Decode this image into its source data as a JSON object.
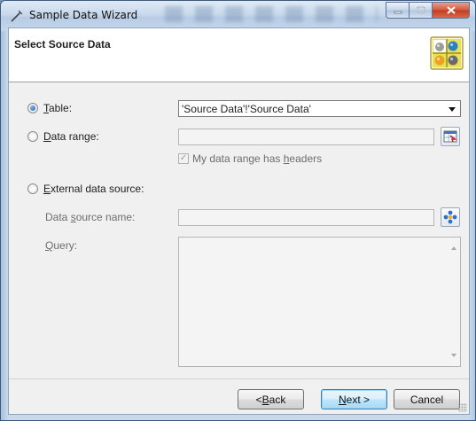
{
  "window": {
    "title": "Sample Data Wizard",
    "icon": "wizard-icon"
  },
  "caption_buttons": {
    "minimize": "minimize-icon",
    "maximize": "maximize-icon",
    "close": "close-icon"
  },
  "header": {
    "title": "Select Source Data",
    "logo": "colored-balls-logo"
  },
  "source": {
    "table": {
      "label_prefix": "",
      "label_accel": "T",
      "label_rest": "able:",
      "selected": true,
      "value": "'Source Data'!'Source Data'"
    },
    "data_range": {
      "label_accel": "D",
      "label_rest": "ata range:",
      "selected": false,
      "value": "",
      "picker_icon": "range-picker-icon"
    },
    "headers_checkbox": {
      "label_pre": "My data range has ",
      "label_accel": "h",
      "label_rest": "eaders",
      "checked": true
    },
    "external": {
      "label_accel": "E",
      "label_rest": "xternal data source:",
      "selected": false
    },
    "data_source_name": {
      "label_pre": "Data ",
      "label_accel": "s",
      "label_rest": "ource name:",
      "value": "",
      "picker_icon": "data-source-picker-icon"
    },
    "query": {
      "label_accel": "Q",
      "label_rest": "uery:",
      "value": ""
    }
  },
  "footer": {
    "back": {
      "pre": "< ",
      "accel": "B",
      "rest": "ack"
    },
    "next": {
      "pre": "",
      "accel": "N",
      "rest": "ext >"
    },
    "cancel": "Cancel"
  },
  "colors": {
    "accent": "#3c7fb1",
    "title_bar": "#c8d9ec",
    "close": "#c23b1e"
  }
}
